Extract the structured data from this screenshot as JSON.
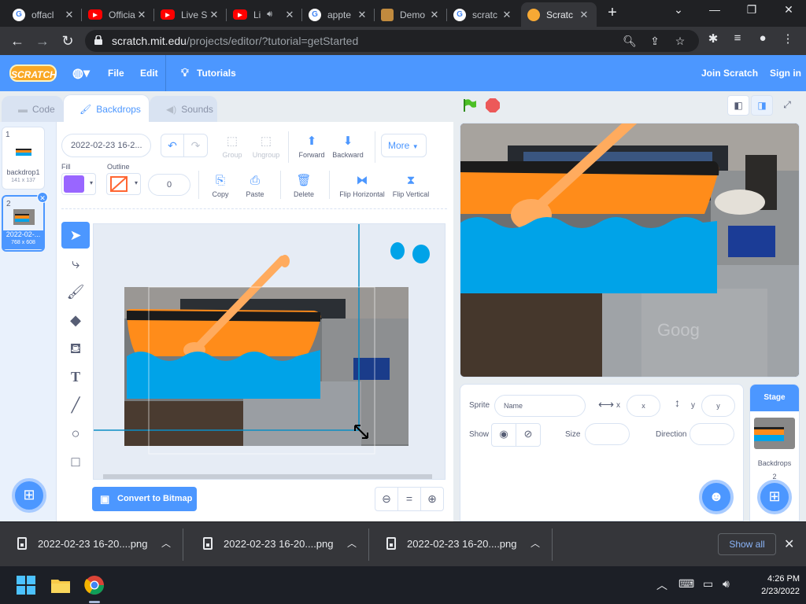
{
  "browser": {
    "tabs": [
      {
        "title": "offacl",
        "favicon": "google",
        "active": false
      },
      {
        "title": "Officia",
        "favicon": "youtube",
        "active": false
      },
      {
        "title": "Live S",
        "favicon": "youtube",
        "active": false
      },
      {
        "title": "Li",
        "favicon": "youtube",
        "active": false,
        "audio": true
      },
      {
        "title": "appte",
        "favicon": "google",
        "active": false
      },
      {
        "title": "Demo",
        "favicon": "box",
        "active": false
      },
      {
        "title": "scratc",
        "favicon": "google",
        "active": false
      },
      {
        "title": "Scratc",
        "favicon": "scratch",
        "active": true
      }
    ],
    "url_host": "scratch.mit.edu",
    "url_path": "/projects/editor/?tutorial=getStarted"
  },
  "scratch_menu": {
    "logo": "SCRATCH",
    "file": "File",
    "edit": "Edit",
    "tutorials": "Tutorials",
    "join": "Join Scratch",
    "signin": "Sign in"
  },
  "editor_tabs": {
    "code": "Code",
    "backdrops": "Backdrops",
    "sounds": "Sounds"
  },
  "backdrop_list": [
    {
      "number": "1",
      "name": "backdrop1",
      "size": "141 x 137"
    },
    {
      "number": "2",
      "name": "2022-02-...",
      "size": "768 x 608",
      "selected": true
    }
  ],
  "paint": {
    "costume_name": "2022-02-23 16-2...",
    "fill_label": "Fill",
    "outline_label": "Outline",
    "outline_width": "0",
    "fill_color": "#9966ff",
    "outline_color": "#ff6633",
    "buttons": {
      "group": "Group",
      "ungroup": "Ungroup",
      "forward": "Forward",
      "backward": "Backward",
      "more": "More",
      "copy": "Copy",
      "paste": "Paste",
      "delete": "Delete",
      "flip_h": "Flip Horizontal",
      "flip_v": "Flip Vertical"
    },
    "convert_label": "Convert to Bitmap"
  },
  "sprite_info": {
    "sprite_label": "Sprite",
    "name_placeholder": "Name",
    "x_label": "x",
    "x_placeholder": "x",
    "y_label": "y",
    "y_placeholder": "y",
    "show_label": "Show",
    "size_label": "Size",
    "direction_label": "Direction"
  },
  "stage_panel": {
    "title": "Stage",
    "backdrops_label": "Backdrops",
    "backdrops_count": "2"
  },
  "downloads": [
    {
      "name": "2022-02-23 16-20....png"
    },
    {
      "name": "2022-02-23 16-20....png"
    },
    {
      "name": "2022-02-23 16-20....png"
    }
  ],
  "downloads_show_all": "Show all",
  "clock": {
    "time": "4:26 PM",
    "date": "2/23/2022"
  },
  "colors": {
    "scratch_blue": "#4c97ff",
    "boat_orange": "#ff8c1a",
    "water_blue": "#00a3e8"
  }
}
